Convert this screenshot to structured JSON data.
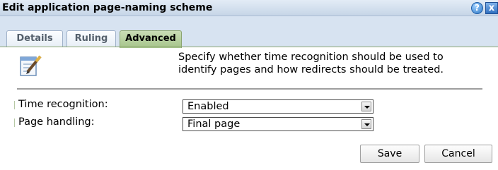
{
  "dialog": {
    "title": "Edit application page-naming scheme",
    "help_symbol": "?",
    "close_symbol": "x"
  },
  "tabs": [
    {
      "label": "Details",
      "active": false
    },
    {
      "label": "Ruling",
      "active": false
    },
    {
      "label": "Advanced",
      "active": true
    }
  ],
  "content": {
    "description_line1": "Specify whether time recognition should be used to",
    "description_line2": "identify pages and how redirects should be treated.",
    "fields": [
      {
        "label": "Time recognition:",
        "value": "Enabled"
      },
      {
        "label": "Page handling:",
        "value": "Final page"
      }
    ]
  },
  "buttons": {
    "save_label": "Save",
    "cancel_label": "Cancel"
  },
  "colors": {
    "titlebar": "#c6d5e7",
    "tab_active": "#a6c58a",
    "tabstrip": "#d7e3f1"
  }
}
